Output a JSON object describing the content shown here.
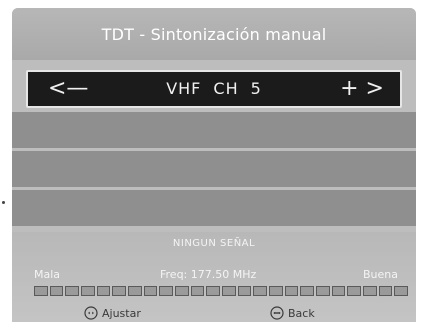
{
  "header": {
    "title": "TDT - Sintonización manual"
  },
  "channel": {
    "left_arrow": "<—",
    "band": "VHF",
    "ch_label": "CH",
    "number": "5",
    "right_arrow": "+ >"
  },
  "signal": {
    "status": "NINGUN SEÑAL",
    "bad_label": "Mala",
    "freq": "Freq: 177.50 MHz",
    "good_label": "Buena",
    "level": 0,
    "segments": 24
  },
  "footer": {
    "adjust_label": "Ajustar",
    "back_label": "Back"
  },
  "colors": {
    "panel": "#bdbdbd",
    "channel_bar": "#1b1b1b",
    "row": "#8f8f8f"
  }
}
